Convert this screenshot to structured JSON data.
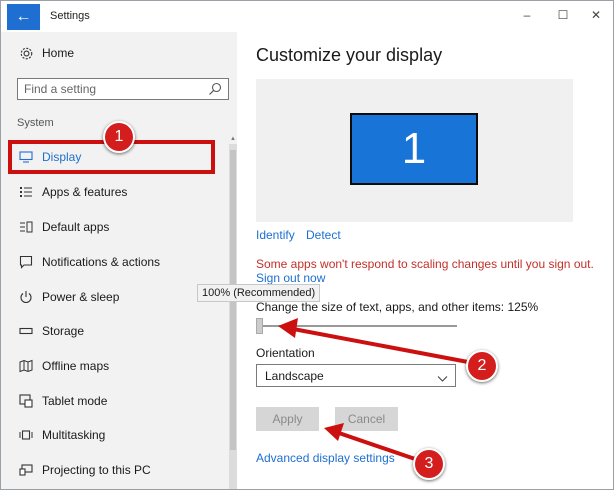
{
  "window": {
    "title": "Settings",
    "back_icon": "←",
    "controls": {
      "minimize": "–",
      "maximize": "☐",
      "close": "✕"
    }
  },
  "sidebar": {
    "home_label": "Home",
    "search_placeholder": "Find a setting",
    "section_label": "System",
    "items": [
      {
        "label": "Display",
        "icon": "monitor-icon",
        "active": true
      },
      {
        "label": "Apps & features",
        "icon": "list-icon"
      },
      {
        "label": "Default apps",
        "icon": "default-apps-icon"
      },
      {
        "label": "Notifications & actions",
        "icon": "notification-icon"
      },
      {
        "label": "Power & sleep",
        "icon": "power-icon"
      },
      {
        "label": "Storage",
        "icon": "storage-icon"
      },
      {
        "label": "Offline maps",
        "icon": "map-icon"
      },
      {
        "label": "Tablet mode",
        "icon": "tablet-icon"
      },
      {
        "label": "Multitasking",
        "icon": "multitasking-icon"
      },
      {
        "label": "Projecting to this PC",
        "icon": "projector-icon"
      }
    ]
  },
  "main": {
    "title": "Customize your display",
    "monitor_number": "1",
    "identify_link": "Identify",
    "detect_link": "Detect",
    "warning_text": "Some apps won't respond to scaling changes until you sign out.",
    "sign_out_link": "Sign out now",
    "scale_label": "Change the size of text, apps, and other items: 125%",
    "slider_tooltip": "100% (Recommended)",
    "slider_value_percent": 100,
    "orientation_label": "Orientation",
    "orientation_value": "Landscape",
    "apply_button": "Apply",
    "cancel_button": "Cancel",
    "advanced_link": "Advanced display settings"
  },
  "annotations": {
    "badge1": "1",
    "badge2": "2",
    "badge3": "3",
    "color": "#cc1010"
  }
}
